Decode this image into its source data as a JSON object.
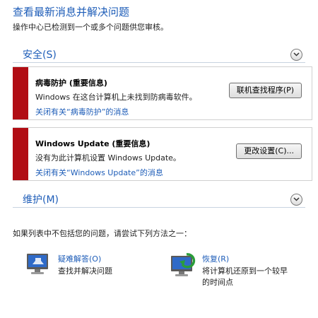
{
  "header": {
    "title": "查看最新消息并解决问题",
    "description": "操作中心已检测到一个或多个问题供您审核。"
  },
  "sections": {
    "security": {
      "title": "安全(S)"
    },
    "maintenance": {
      "title": "维护(M)"
    }
  },
  "messages": [
    {
      "title": "病毒防护 (重要信息)",
      "body": "Windows 在这台计算机上未找到防病毒软件。",
      "link": "关闭有关“病毒防护”的消息",
      "button": "联机查找程序(P)"
    },
    {
      "title": "Windows Update (重要信息)",
      "body": "没有为此计算机设置 Windows Update。",
      "link": "关闭有关“Windows Update”的消息",
      "button": "更改设置(C)..."
    }
  ],
  "hint": "如果列表中不包括您的问题，请尝试下列方法之一：",
  "tools": [
    {
      "link": "疑难解答(O)",
      "desc": "查找并解决问题",
      "icon": "troubleshoot-icon"
    },
    {
      "link": "恢复(R)",
      "desc": "将计算机还原到一个较早的时间点",
      "icon": "recovery-icon"
    }
  ],
  "colors": {
    "accent": "#1e5db8",
    "alert": "#b10d14"
  }
}
